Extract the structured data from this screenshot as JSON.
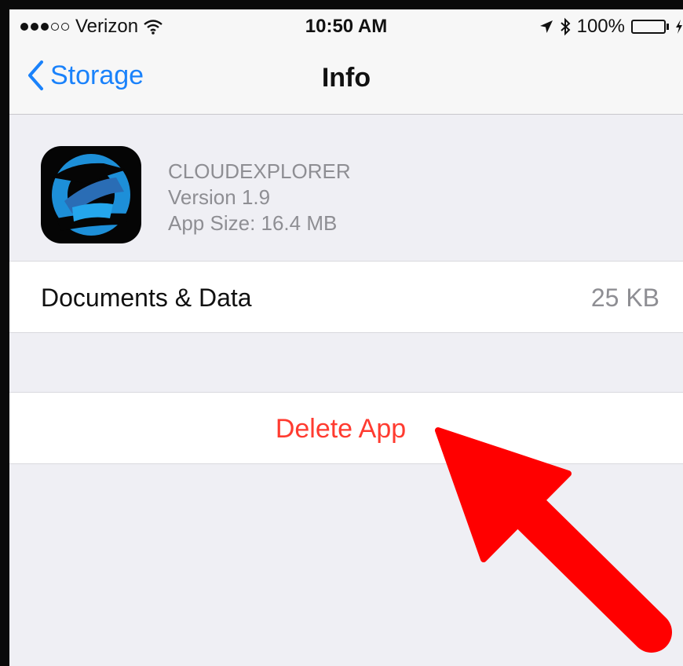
{
  "status_bar": {
    "carrier": "Verizon",
    "time": "10:50 AM",
    "battery": "100%",
    "signal_bars_filled": 3,
    "signal_bars_total": 5,
    "battery_level": 1.0,
    "icons": [
      "wifi-icon",
      "location-arrow-icon",
      "bluetooth-icon",
      "battery-icon",
      "charging-bolt-icon"
    ]
  },
  "nav": {
    "back_label": "Storage",
    "title": "Info"
  },
  "app": {
    "name": "CLOUDEXPLORER",
    "version": "Version 1.9",
    "size": "App Size: 16.4 MB",
    "icon": "cloudexplorer-app-icon"
  },
  "documents": {
    "label": "Documents & Data",
    "value": "25 KB"
  },
  "actions": {
    "delete_label": "Delete App"
  },
  "colors": {
    "accent_blue": "#1a82fb",
    "destructive_red": "#ff3b30",
    "battery_green": "#4cd964",
    "annotation_arrow": "#ff0000"
  }
}
